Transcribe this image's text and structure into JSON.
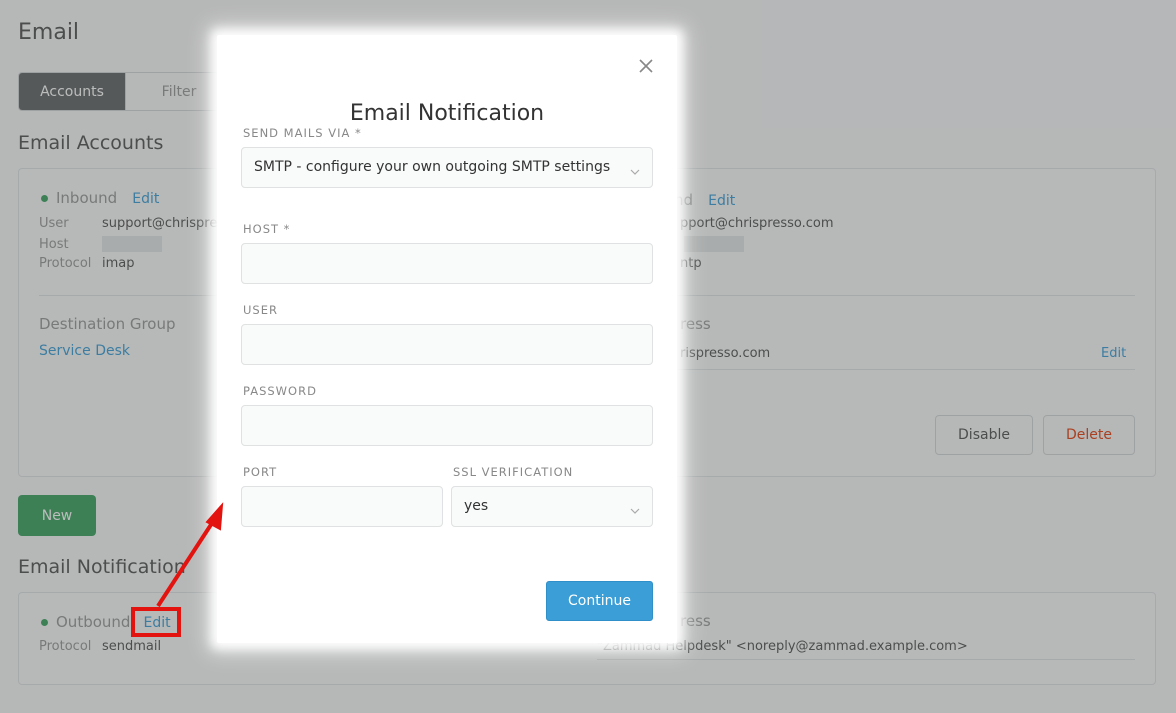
{
  "page": {
    "title": "Email",
    "tabs": [
      {
        "label": "Accounts"
      },
      {
        "label": "Filter"
      }
    ],
    "email_accounts": {
      "title": "Email Accounts",
      "inbound": {
        "label": "Inbound",
        "edit_label": "Edit",
        "rows": [
          {
            "key": "User",
            "value": "support@chrispre"
          },
          {
            "key": "Host",
            "value": ""
          },
          {
            "key": "Protocol",
            "value": "imap"
          }
        ]
      },
      "outbound": {
        "label_partial": "nd",
        "edit_label": "Edit",
        "user_partial": "pport@chrispresso.com",
        "protocol_partial": "ntp"
      },
      "destination_group": {
        "label": "Destination Group",
        "value": "Service Desk"
      },
      "email_address": {
        "label_partial": "ress",
        "value_partial": "rispresso.com",
        "edit_label": "Edit"
      },
      "disable_label": "Disable",
      "delete_label": "Delete"
    },
    "new_label": "New",
    "email_notification": {
      "title": "Email Notification",
      "outbound_label": "Outbound",
      "edit_label": "Edit",
      "protocol_key": "Protocol",
      "protocol_value": "sendmail",
      "address_label_partial": "ress",
      "address_value": "\"Zammad Helpdesk\" <noreply@zammad.example.com>"
    }
  },
  "modal": {
    "title": "Email Notification",
    "send_via_label": "SEND MAILS VIA *",
    "send_via_value": "SMTP - configure your own outgoing SMTP settings",
    "host_label": "HOST *",
    "host_value": "",
    "user_label": "USER",
    "user_value": "",
    "password_label": "PASSWORD",
    "password_value": "",
    "port_label": "PORT",
    "port_value": "",
    "ssl_label": "SSL VERIFICATION",
    "ssl_value": "yes",
    "continue_label": "Continue"
  },
  "colors": {
    "accent": "#3c9ed6",
    "success": "#3fa463",
    "danger": "#e54011",
    "annotation": "#e3140f"
  },
  "icons": [
    "close-icon",
    "chevron-down-icon",
    "status-dot-icon",
    "annotation-arrow"
  ]
}
